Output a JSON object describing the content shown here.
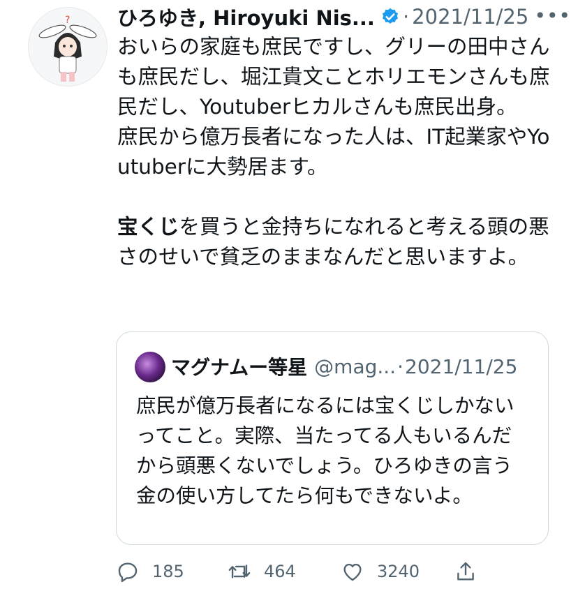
{
  "tweet": {
    "author_name": "ひろゆき, Hiroyuki Nis...",
    "separator": "·",
    "date": "2021/11/25",
    "more_label": "•••",
    "text_part1": "おいらの家庭も庶民ですし、グリーの田中さんも庶民だし、堀江貴文ことホリエモンさんも庶民だし、Youtuberヒカルさんも庶民出身。\n庶民から億万長者になった人は、IT起業家やYoutuberに大勢居ます。\n\n",
    "text_bold": "宝くじ",
    "text_part2": "を買うと金持ちになれると考える頭の悪さのせいで貧乏のままなんだと思いますよ。"
  },
  "quote": {
    "author_name": "マグナムー等星",
    "handle": "@mag...",
    "separator": "·",
    "date": "2021/11/25",
    "text": "庶民が億万長者になるには宝くじしかないってこと。実際、当たってる人もいるんだから頭悪くないでしょう。ひろゆきの言う金の使い方してたら何もできないよ。"
  },
  "actions": {
    "reply_count": "185",
    "retweet_count": "464",
    "like_count": "3240"
  },
  "colors": {
    "text": "#0f1419",
    "secondary": "#536471",
    "verified": "#1d9bf0",
    "border": "#cfd9de"
  },
  "icons": [
    "reply-icon",
    "retweet-icon",
    "like-icon",
    "share-icon",
    "verified-badge-icon",
    "more-options-icon"
  ]
}
